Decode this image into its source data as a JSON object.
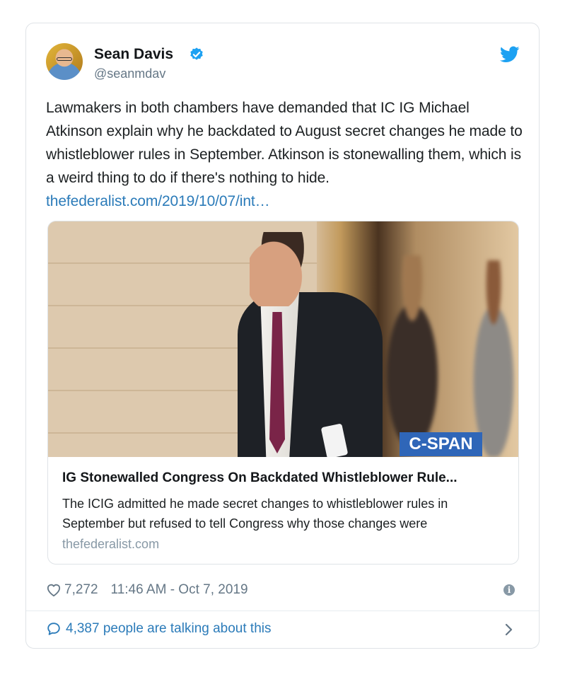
{
  "tweet": {
    "author_name": "Sean Davis",
    "handle": "@seanmdav",
    "text": "Lawmakers in both chambers have demanded that IC IG Michael Atkinson explain why he backdated to August secret changes he made to whistleblower rules in September. Atkinson is stonewalling them, which is a weird thing to do if there's nothing to hide.",
    "link_text": "thefederalist.com/2019/10/07/int…",
    "likes": "7,272",
    "timestamp": "11:46 AM - Oct 7, 2019",
    "talking": "4,387 people are talking about this"
  },
  "card": {
    "badge": "C-SPAN",
    "title": "IG Stonewalled Congress On Backdated Whistleblower Rule...",
    "description": "The ICIG admitted he made secret changes to whistleblower rules in September but refused to tell Congress why those changes were",
    "domain": "thefederalist.com"
  },
  "icons": {
    "verified": "verified-badge-icon",
    "bird": "twitter-bird-icon",
    "heart": "heart-icon",
    "info": "info-icon",
    "chat": "speech-bubble-icon",
    "chevron": "chevron-right-icon"
  },
  "colors": {
    "link": "#2b7bb9",
    "muted": "#657786",
    "verified": "#1da1f2",
    "cspan": "#2f66b8"
  }
}
